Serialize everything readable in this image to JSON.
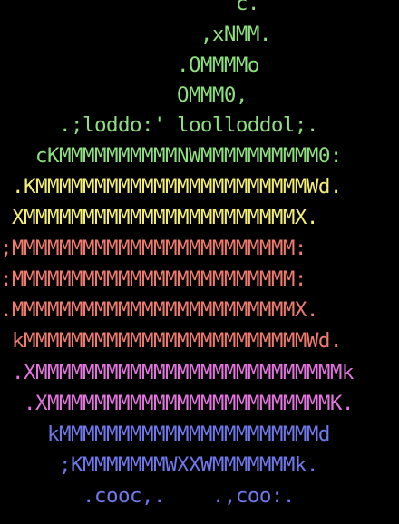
{
  "palette": {
    "background": "#000000",
    "green": "#8ee07e",
    "yellow": "#f4ef72",
    "red": "#f07a6e",
    "magenta": "#e474e0",
    "blue": "#6f79ec"
  },
  "ascii_logo": {
    "lines": [
      "                    c.",
      "                 ,xNMM.",
      "               .OMMMMo",
      "               OMMM0,",
      "     .;loddo:' loolloddol;.",
      "   cKMMMMMMMMMMNWMMMMMMMMMM0:",
      " .KMMMMMMMMMMMMMMMMMMMMMMMWd.",
      " XMMMMMMMMMMMMMMMMMMMMMMMX.",
      ";MMMMMMMMMMMMMMMMMMMMMMMM:",
      ":MMMMMMMMMMMMMMMMMMMMMMMM:",
      ".MMMMMMMMMMMMMMMMMMMMMMMMX.",
      " kMMMMMMMMMMMMMMMMMMMMMMMMWd.",
      " .XMMMMMMMMMMMMMMMMMMMMMMMMMMk",
      "  .XMMMMMMMMMMMMMMMMMMMMMMMMK.",
      "    kMMMMMMMMMMMMMMMMMMMMMMd",
      "     ;KMMMMMMMWXXWMMMMMMMk.",
      "       .cooc,.    .,coo:."
    ]
  }
}
